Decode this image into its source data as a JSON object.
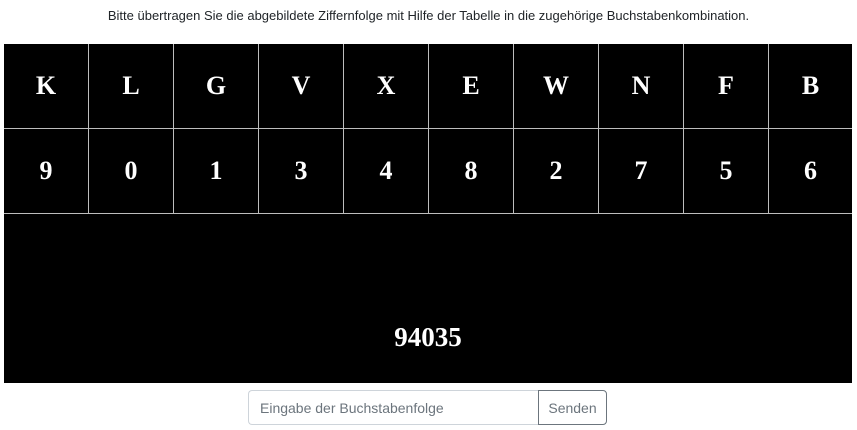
{
  "instruction": "Bitte übertragen Sie die abgebildete Ziffernfolge mit Hilfe der Tabelle in die zugehörige Buchstabenkombination.",
  "table": {
    "letters": [
      "K",
      "L",
      "G",
      "V",
      "X",
      "E",
      "W",
      "N",
      "F",
      "B"
    ],
    "digits": [
      "9",
      "0",
      "1",
      "3",
      "4",
      "8",
      "2",
      "7",
      "5",
      "6"
    ]
  },
  "code": "94035",
  "form": {
    "input_placeholder": "Eingabe der Buchstabenfolge",
    "input_value": "",
    "submit_label": "Senden"
  },
  "colors": {
    "panel_background": "#000000",
    "panel_text": "#ffffff",
    "grid_lines": "#bdbdbd",
    "button_border": "#6c757d"
  }
}
